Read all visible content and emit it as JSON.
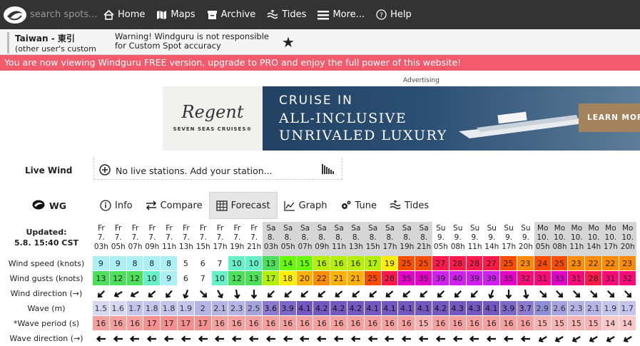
{
  "nav": {
    "search_placeholder": "search spots...",
    "items": [
      {
        "label": "Home",
        "icon": "home-icon"
      },
      {
        "label": "Maps",
        "icon": "map-icon"
      },
      {
        "label": "Archive",
        "icon": "archive-icon"
      },
      {
        "label": "Tides",
        "icon": "tides-icon"
      },
      {
        "label": "More...",
        "icon": "menu-icon"
      },
      {
        "label": "Help",
        "icon": "help-icon"
      }
    ]
  },
  "spot": {
    "name": "Taiwan - 東引",
    "sub": "(other user's custom spot)",
    "warning": "Warning! Windguru is not responsible for Custom Spot accuracy",
    "star": "★"
  },
  "pro_banner": "You are now viewing Windguru FREE version, upgrade to PRO and enjoy the full power of this website!",
  "ad": {
    "label": "Advertising",
    "brand": "Regent",
    "brand_sub": "SEVEN SEAS CRUISES®",
    "line1": "CRUISE IN",
    "line2": "ALL-INCLUSIVE",
    "line3": "UNRIVALED LUXURY",
    "cta": "LEARN MORE"
  },
  "live": {
    "label": "Live Wind",
    "text": "No live stations. Add your station..."
  },
  "model": {
    "label": "WG",
    "tabs": [
      {
        "label": "Info",
        "icon": "info-icon",
        "active": false
      },
      {
        "label": "Compare",
        "icon": "compare-icon",
        "active": false
      },
      {
        "label": "Forecast",
        "icon": "table-icon",
        "active": true
      },
      {
        "label": "Graph",
        "icon": "graph-icon",
        "active": false
      },
      {
        "label": "Tune",
        "icon": "gear-icon",
        "active": false
      },
      {
        "label": "Tides",
        "icon": "tides-icon",
        "active": false
      }
    ]
  },
  "forecast": {
    "updated_label": "Updated:",
    "updated_value": "5.8. 15:40 CST",
    "row_labels": [
      "Wind speed (knots)",
      "Wind gusts (knots)",
      "Wind direction (→)",
      "Wave (m)",
      "*Wave period (s)",
      "Wave direction (→)"
    ],
    "columns": [
      {
        "day": "Fr",
        "date": "7.",
        "time": "03h",
        "ws": 9,
        "wg": 13,
        "wd": 315,
        "wave": "1.5",
        "per": 16,
        "wvd": 100
      },
      {
        "day": "Fr",
        "date": "7.",
        "time": "05h",
        "ws": 9,
        "wg": 12,
        "wd": 330,
        "wave": "1.6",
        "per": 16,
        "wvd": 100
      },
      {
        "day": "Fr",
        "date": "7.",
        "time": "07h",
        "ws": 8,
        "wg": 12,
        "wd": 330,
        "wave": "1.7",
        "per": 16,
        "wvd": 100
      },
      {
        "day": "Fr",
        "date": "7.",
        "time": "09h",
        "ws": 8,
        "wg": 10,
        "wd": 320,
        "wave": "1.8",
        "per": 17,
        "wvd": 100
      },
      {
        "day": "Fr",
        "date": "7.",
        "time": "11h",
        "ws": 8,
        "wg": 9,
        "wd": 310,
        "wave": "1.8",
        "per": 17,
        "wvd": 100
      },
      {
        "day": "Fr",
        "date": "7.",
        "time": "13h",
        "ws": 5,
        "wg": 6,
        "wd": 290,
        "wave": "1.9",
        "per": 17,
        "wvd": 100
      },
      {
        "day": "Fr",
        "date": "7.",
        "time": "15h",
        "ws": 6,
        "wg": 7,
        "wd": 225,
        "wave": "2",
        "per": 17,
        "wvd": 100
      },
      {
        "day": "Fr",
        "date": "7.",
        "time": "17h",
        "ws": 7,
        "wg": 10,
        "wd": 240,
        "wave": "2.1",
        "per": 16,
        "wvd": 100
      },
      {
        "day": "Fr",
        "date": "7.",
        "time": "19h",
        "ws": 10,
        "wg": 12,
        "wd": 260,
        "wave": "2.3",
        "per": 16,
        "wvd": 100
      },
      {
        "day": "Fr",
        "date": "7.",
        "time": "21h",
        "ws": 10,
        "wg": 13,
        "wd": 270,
        "wave": "2.5",
        "per": 16,
        "wvd": 100
      },
      {
        "day": "Sa",
        "date": "8.",
        "time": "03h",
        "ws": 13,
        "wg": 17,
        "wd": 315,
        "wave": "3.6",
        "per": 16,
        "wvd": 100
      },
      {
        "day": "Sa",
        "date": "8.",
        "time": "05h",
        "ws": 14,
        "wg": 18,
        "wd": 320,
        "wave": "3.9",
        "per": 16,
        "wvd": 100
      },
      {
        "day": "Sa",
        "date": "8.",
        "time": "07h",
        "ws": 15,
        "wg": 20,
        "wd": 320,
        "wave": "4.1",
        "per": 16,
        "wvd": 100
      },
      {
        "day": "Sa",
        "date": "8.",
        "time": "09h",
        "ws": 16,
        "wg": 22,
        "wd": 320,
        "wave": "4.2",
        "per": 16,
        "wvd": 100
      },
      {
        "day": "Sa",
        "date": "8.",
        "time": "11h",
        "ws": 16,
        "wg": 21,
        "wd": 320,
        "wave": "4.2",
        "per": 16,
        "wvd": 100
      },
      {
        "day": "Sa",
        "date": "8.",
        "time": "13h",
        "ws": 16,
        "wg": 21,
        "wd": 320,
        "wave": "4.2",
        "per": 16,
        "wvd": 100
      },
      {
        "day": "Sa",
        "date": "8.",
        "time": "15h",
        "ws": 17,
        "wg": 25,
        "wd": 320,
        "wave": "4.1",
        "per": 16,
        "wvd": 100
      },
      {
        "day": "Sa",
        "date": "8.",
        "time": "17h",
        "ws": 19,
        "wg": 28,
        "wd": 320,
        "wave": "4.1",
        "per": 16,
        "wvd": 100
      },
      {
        "day": "Sa",
        "date": "8.",
        "time": "19h",
        "ws": 25,
        "wg": 35,
        "wd": 320,
        "wave": "4.1",
        "per": 16,
        "wvd": 100
      },
      {
        "day": "Sa",
        "date": "8.",
        "time": "21h",
        "ws": 25,
        "wg": 35,
        "wd": 320,
        "wave": "4.1",
        "per": 15,
        "wvd": 100
      },
      {
        "day": "Su",
        "date": "9.",
        "time": "05h",
        "ws": 27,
        "wg": 39,
        "wd": 315,
        "wave": "4.2",
        "per": 16,
        "wvd": 100
      },
      {
        "day": "Su",
        "date": "9.",
        "time": "08h",
        "ws": 28,
        "wg": 40,
        "wd": 315,
        "wave": "4.3",
        "per": 16,
        "wvd": 100
      },
      {
        "day": "Su",
        "date": "9.",
        "time": "11h",
        "ws": 28,
        "wg": 39,
        "wd": 315,
        "wave": "4.3",
        "per": 16,
        "wvd": 100
      },
      {
        "day": "Su",
        "date": "9.",
        "time": "14h",
        "ws": 27,
        "wg": 39,
        "wd": 290,
        "wave": "4.1",
        "per": 16,
        "wvd": 100
      },
      {
        "day": "Su",
        "date": "9.",
        "time": "17h",
        "ws": 25,
        "wg": 35,
        "wd": 270,
        "wave": "3.9",
        "per": 16,
        "wvd": 100
      },
      {
        "day": "Su",
        "date": "9.",
        "time": "20h",
        "ws": 23,
        "wg": 32,
        "wd": 260,
        "wave": "3.7",
        "per": 16,
        "wvd": 100
      },
      {
        "day": "Mo",
        "date": "10.",
        "time": "05h",
        "ws": 24,
        "wg": 31,
        "wd": 225,
        "wave": "2.9",
        "per": 15,
        "wvd": 70
      },
      {
        "day": "Mo",
        "date": "10.",
        "time": "08h",
        "ws": 25,
        "wg": 33,
        "wd": 225,
        "wave": "2.6",
        "per": 15,
        "wvd": 70
      },
      {
        "day": "Mo",
        "date": "10.",
        "time": "11h",
        "ws": 23,
        "wg": 31,
        "wd": 225,
        "wave": "2.3",
        "per": 15,
        "wvd": 70
      },
      {
        "day": "Mo",
        "date": "10.",
        "time": "14h",
        "ws": 22,
        "wg": 28,
        "wd": 225,
        "wave": "2.1",
        "per": 15,
        "wvd": 70
      },
      {
        "day": "Mo",
        "date": "10.",
        "time": "17h",
        "ws": 22,
        "wg": 31,
        "wd": 225,
        "wave": "1.9",
        "per": 14,
        "wvd": 70
      },
      {
        "day": "Mo",
        "date": "10.",
        "time": "20h",
        "ws": 23,
        "wg": 32,
        "wd": 225,
        "wave": "1.7",
        "per": 14,
        "wvd": 70
      }
    ]
  },
  "colors": {
    "nav_bg": "#333333",
    "pro_banner_bg": "#f35b6d",
    "weekend_header_bg": "#d6d6d6",
    "tab_active_bg": "#e6e6e6"
  }
}
